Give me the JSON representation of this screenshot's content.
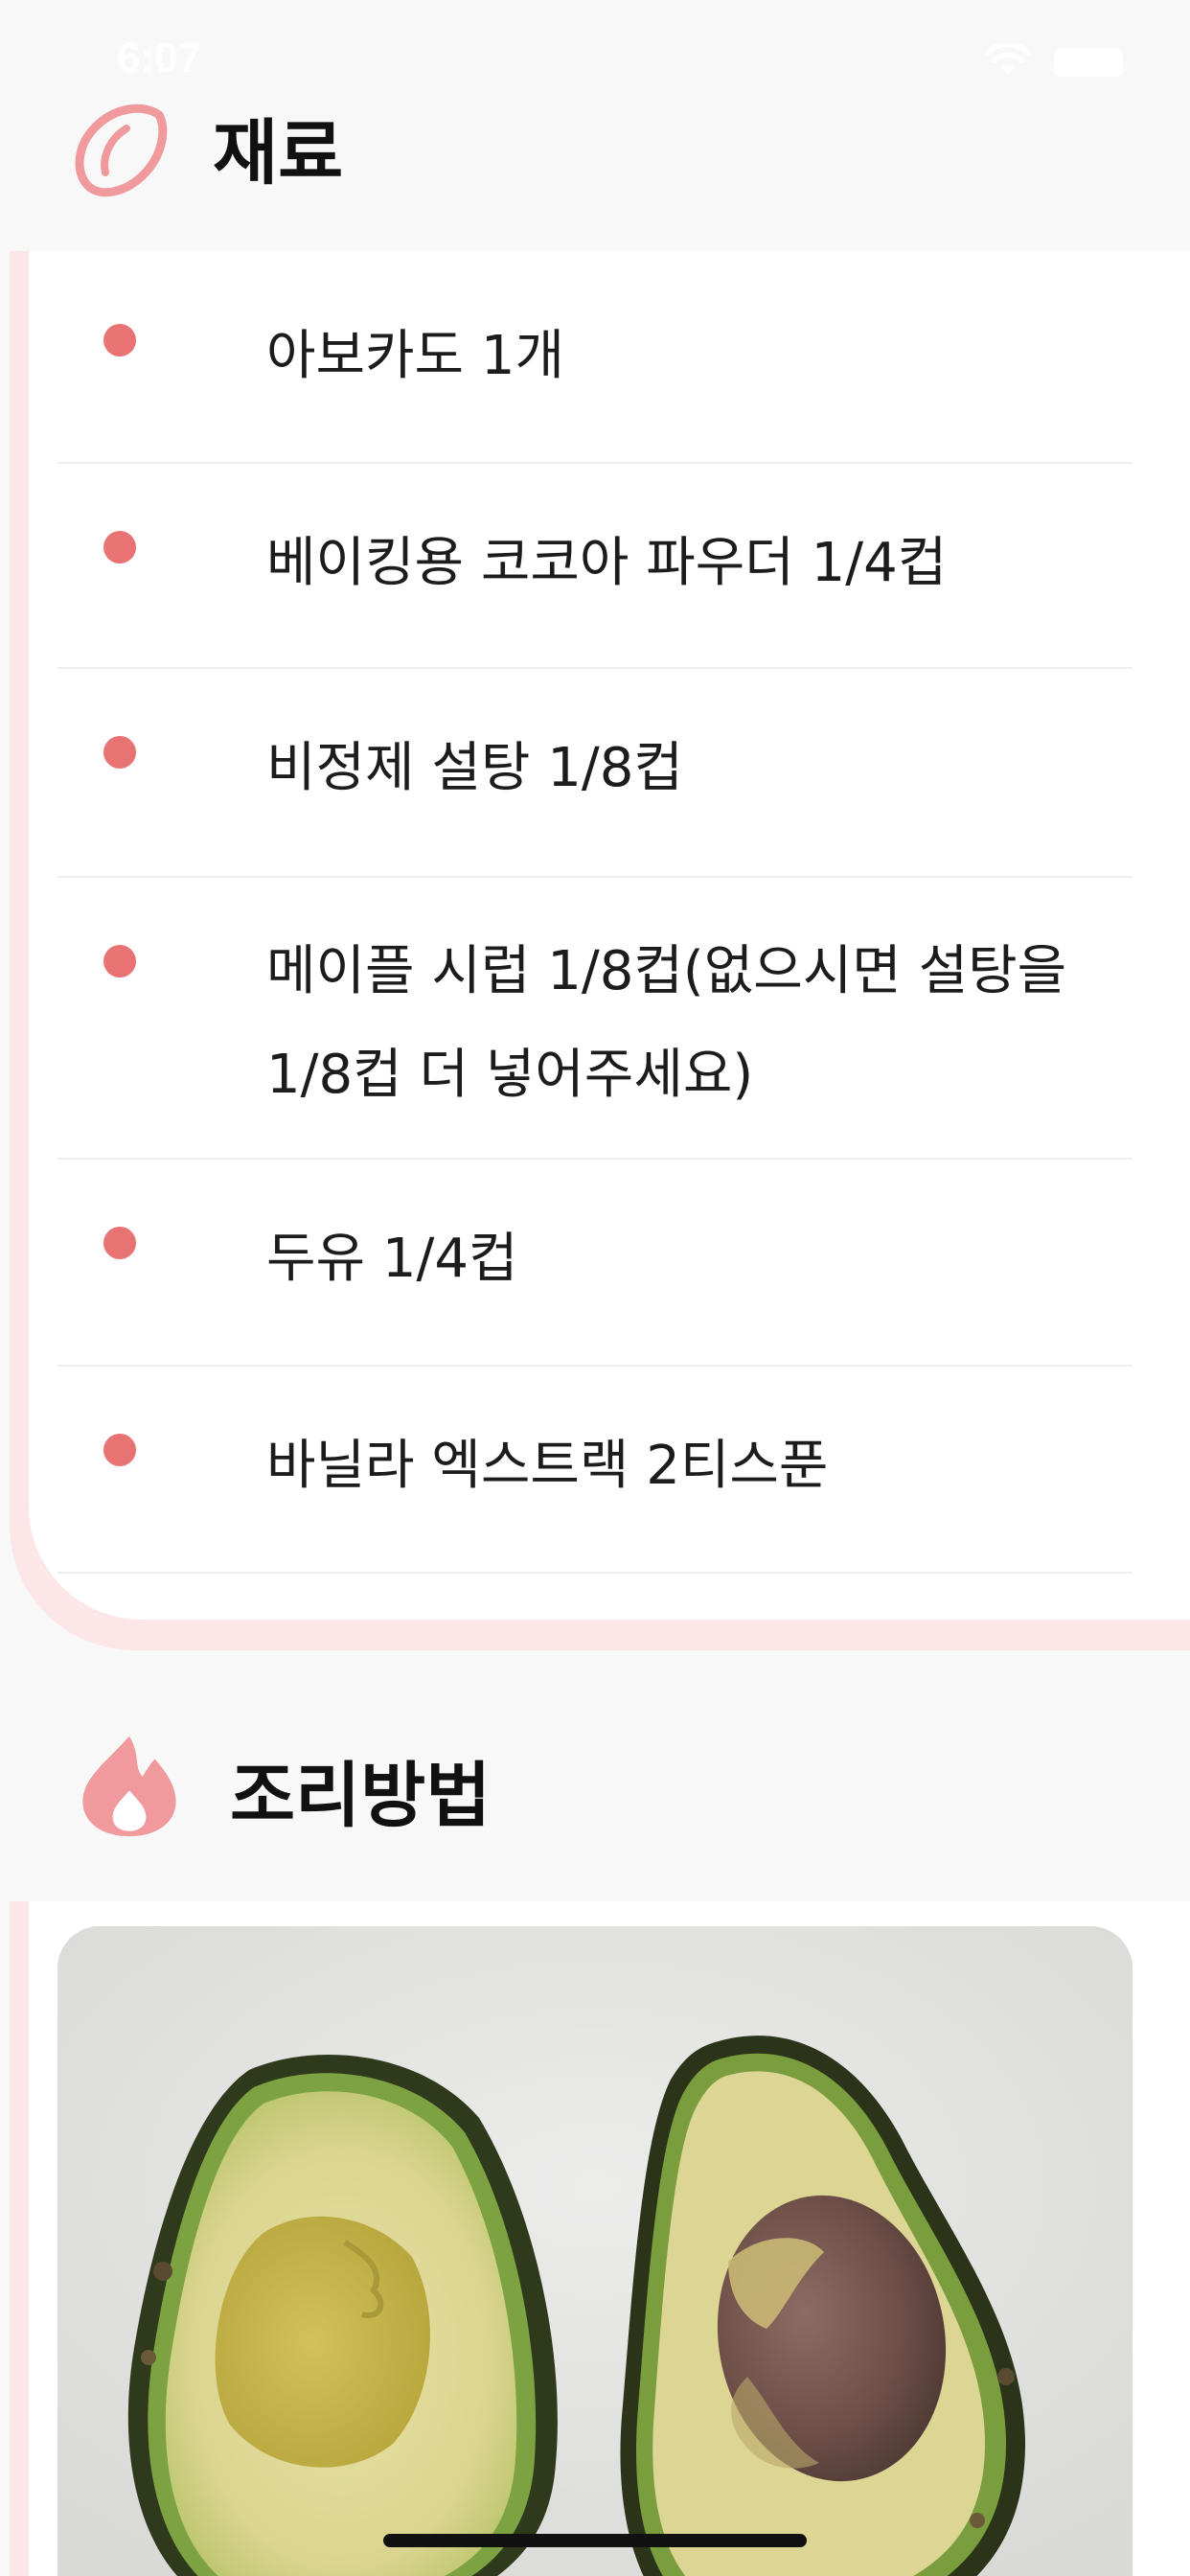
{
  "status_bar": {
    "time": "6:07"
  },
  "ingredients": {
    "title": "재료",
    "icon": "lemon-icon",
    "items": [
      "아보카도 1개",
      "베이킹용 코코아 파우더 1/4컵",
      "비정제 설탕 1/8컵",
      "메이플 시럽 1/8컵(없으시면 설탕을 1/8컵 더 넣어주세요)",
      "두유 1/4컵",
      "바닐라 엑스트랙 2티스푼"
    ]
  },
  "directions": {
    "title": "조리방법",
    "icon": "flame-icon",
    "photo": "avocado-halves-photo"
  },
  "colors": {
    "accent": "#e77373",
    "accent_light": "#fde6e8",
    "icon_pink": "#f19a9e",
    "background": "#f8f8f8"
  }
}
